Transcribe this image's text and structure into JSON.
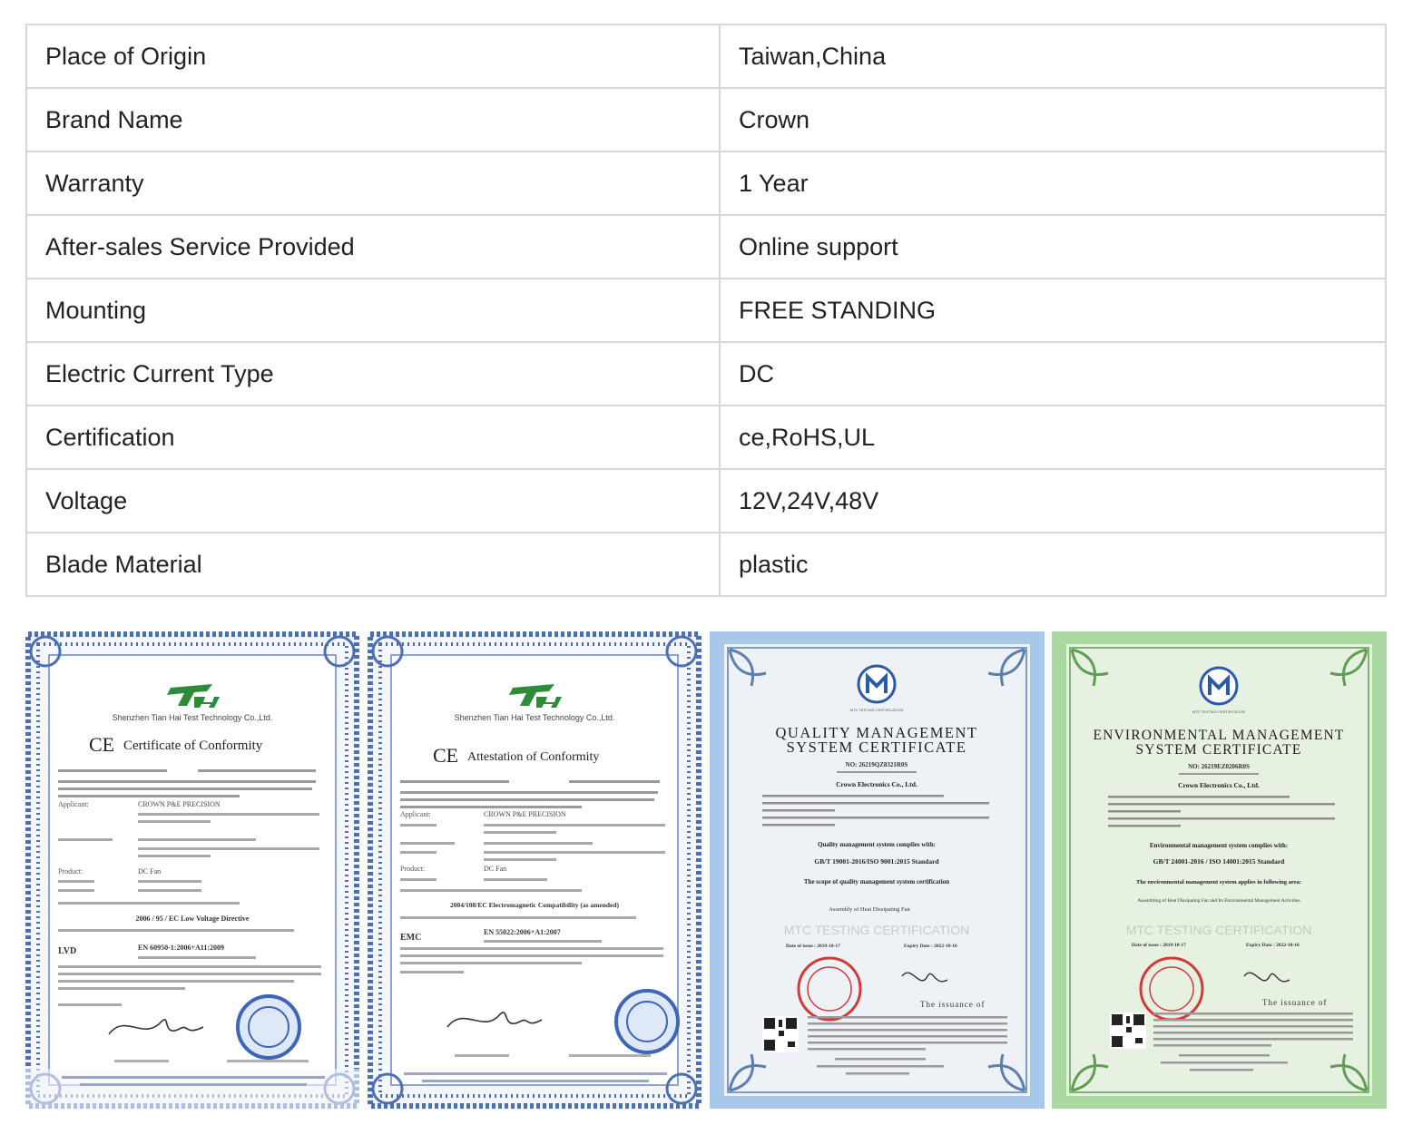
{
  "specs": [
    {
      "label": "Place of Origin",
      "value": "Taiwan,China"
    },
    {
      "label": "Brand Name",
      "value": "Crown"
    },
    {
      "label": "Warranty",
      "value": "1 Year"
    },
    {
      "label": "After-sales Service Provided",
      "value": "Online support"
    },
    {
      "label": "Mounting",
      "value": "FREE STANDING"
    },
    {
      "label": "Electric Current Type",
      "value": "DC"
    },
    {
      "label": "Certification",
      "value": "ce,RoHS,UL"
    },
    {
      "label": "Voltage",
      "value": "12V,24V,48V"
    },
    {
      "label": "Blade Material",
      "value": "plastic"
    }
  ],
  "certificates": [
    {
      "company": "Shenzhen Tian Hai Test Technology Co.,Ltd.",
      "title": "Certificate of Conformity",
      "applicant": "CROWN P&E PRECISION",
      "product": "DC Fan",
      "directive": "2006 / 95 / EC Low Voltage Directive",
      "standard_label": "LVD",
      "standard": "EN 60950-1:2006+A11:2009",
      "frame_color": "#4a6fb5"
    },
    {
      "company": "Shenzhen Tian Hai Test Technology Co.,Ltd.",
      "title": "Attestation of Conformity",
      "applicant": "CROWN P&E PRECISION",
      "product": "DC Fan",
      "directive": "2004/108/EC Electromagnetic Compatibility (as amended)",
      "standard_label": "EMC",
      "standard": "EN 55022:2006+A1:2007",
      "frame_color": "#4a6fb5"
    },
    {
      "logo_caption": "MTC TESTING CERTIFICATION",
      "title_line1": "QUALITY MANAGEMENT",
      "title_line2": "SYSTEM CERTIFICATE",
      "number": "NO: 26219QZ8321R0S",
      "company": "Crown Electronics Co., Ltd.",
      "heading": "Quality management system complies with:",
      "standard": "GB/T 19001-2016/ISO 9001:2015 Standard",
      "scope": "The scope of quality management system certification",
      "activity": "Assembly of Heat Dissipating Fan",
      "issue_date": "Date of issue : 2019-10-17",
      "expiry_date": "Expiry Date : 2022-10-16",
      "issuance": "The issuance of",
      "watermark": "MTC TESTING CERTIFICATION",
      "bg_color": "#a8c8ea"
    },
    {
      "logo_caption": "MTC TESTING CERTIFICATION",
      "title_line1": "ENVIRONMENTAL MANAGEMENT",
      "title_line2": "SYSTEM CERTIFICATE",
      "number": "NO: 26219EZ0206R0S",
      "company": "Crown Electronics Co., Ltd.",
      "heading": "Environmental management system complies with:",
      "standard": "GB/T 24001-2016 / ISO 14001:2015 Standard",
      "scope": "The environmental management system applies in following area:",
      "activity": "Assembling of Heat Dissipating Fan and Its Environmental Management Activities",
      "issue_date": "Date of issue : 2019-10-17",
      "expiry_date": "Expiry Date : 2022-10-16",
      "issuance": "The issuance of",
      "watermark": "MTC TESTING CERTIFICATION",
      "bg_color": "#a9d8a0"
    }
  ]
}
